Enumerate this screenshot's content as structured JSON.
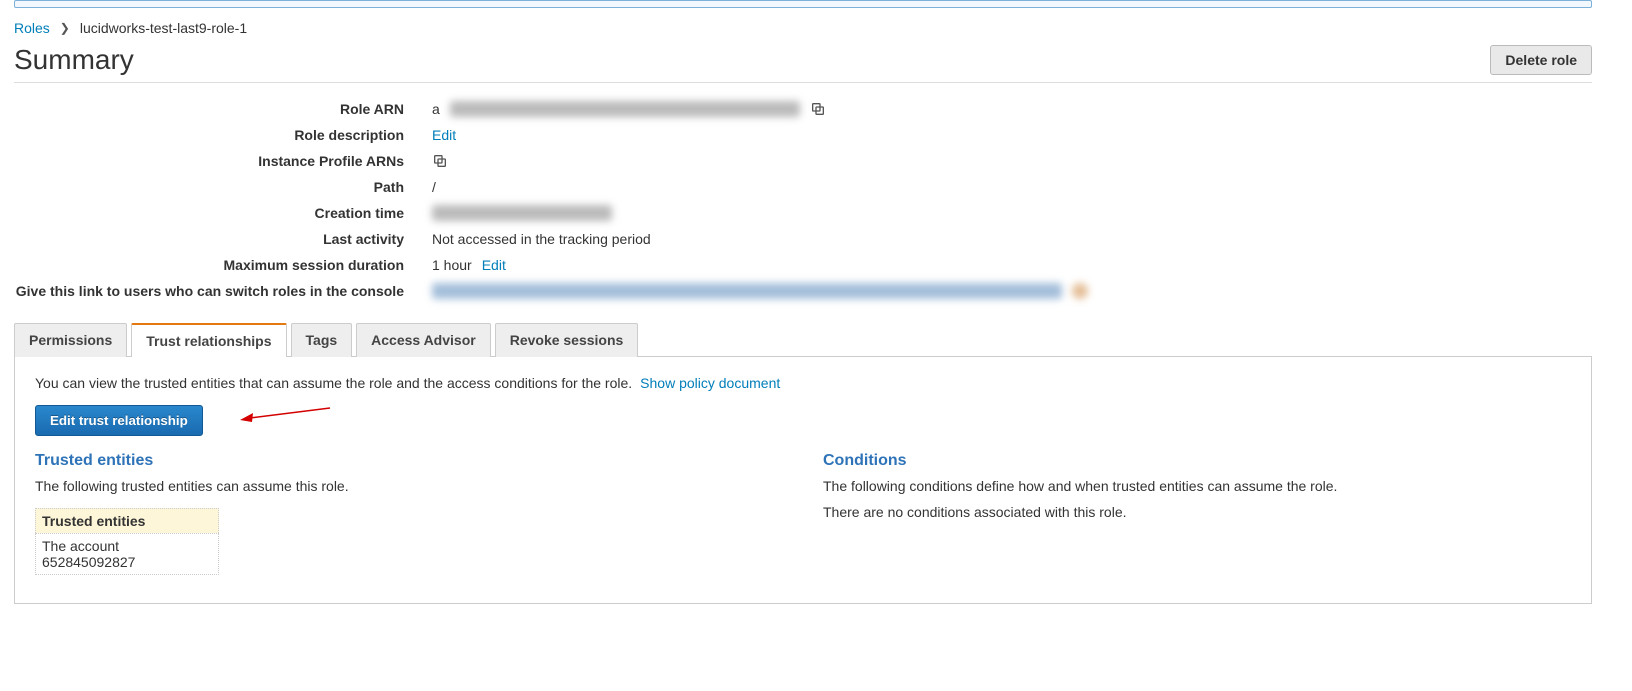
{
  "breadcrumb": {
    "root": "Roles",
    "current": "lucidworks-test-last9-role-1"
  },
  "heading": "Summary",
  "delete_button": "Delete role",
  "details": {
    "labels": {
      "role_arn": "Role ARN",
      "role_description": "Role description",
      "instance_profile_arns": "Instance Profile ARNs",
      "path": "Path",
      "creation_time": "Creation time",
      "last_activity": "Last activity",
      "max_session": "Maximum session duration",
      "switch_link": "Give this link to users who can switch roles in the console"
    },
    "values": {
      "role_arn_prefix": "a",
      "edit": "Edit",
      "path": "/",
      "last_activity": "Not accessed in the tracking period",
      "max_session_value": "1 hour",
      "max_session_edit": "Edit"
    }
  },
  "tabs": {
    "permissions": "Permissions",
    "trust": "Trust relationships",
    "tags": "Tags",
    "access_advisor": "Access Advisor",
    "revoke": "Revoke sessions"
  },
  "trust_panel": {
    "desc": "You can view the trusted entities that can assume the role and the access conditions for the role.",
    "show_policy": "Show policy document",
    "edit_button": "Edit trust relationship",
    "trusted_entities_heading": "Trusted entities",
    "trusted_entities_desc": "The following trusted entities can assume this role.",
    "trusted_table_header": "Trusted entities",
    "trusted_table_value": "The account 652845092827",
    "conditions_heading": "Conditions",
    "conditions_desc": "The following conditions define how and when trusted entities can assume the role.",
    "conditions_empty": "There are no conditions associated with this role."
  }
}
